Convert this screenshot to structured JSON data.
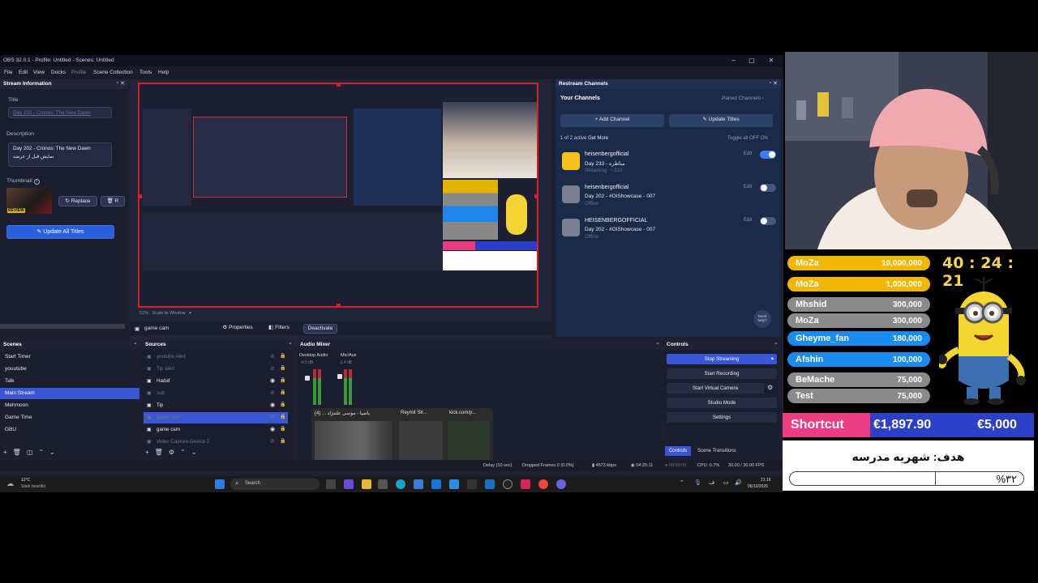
{
  "app": {
    "title": "OBS 32.0.1 - Profile: Untitled - Scenes: Untitled",
    "menu": [
      "File",
      "Edit",
      "View",
      "Docks",
      "Profile",
      "Scene Collection",
      "Tools",
      "Help"
    ]
  },
  "stream_info": {
    "dock_title": "Stream Information",
    "title_label": "Title",
    "title_value": "Day 202 - Cronos: The New Dawn",
    "description_label": "Description",
    "description_line1": "Day 202 - Cronos: The New Dawn",
    "description_line2": "نمایش قبل از عرضه",
    "thumbnail_label": "Thumbnail",
    "thumbnail_badge": "REVIEW",
    "replace_label": "Replace",
    "remove_label": "R",
    "update_all_label": "Update All Titles"
  },
  "preview": {
    "zoom": "51%",
    "scale_label": "Scale to Window"
  },
  "source_toolbar": {
    "source_name": "game cam",
    "properties_label": "Properties",
    "filters_label": "Filters",
    "deactivate_label": "Deactivate"
  },
  "restream": {
    "dock_title": "Restream Channels",
    "your_channels": "Your Channels",
    "paired_channels": "Paired Channels",
    "add_channel": "Add Channel",
    "update_titles": "Update Titles",
    "active_count": "1 of 2 active",
    "get_more": "Get More",
    "toggle_all": "Toggle all OFF",
    "toggle_all_on": "ON",
    "channels": [
      {
        "name": "heisenbergofficial",
        "title": "Day 233 - مناظره",
        "status": "Streaming",
        "viewers": "210",
        "edit": "Edit",
        "on": true
      },
      {
        "name": "heisenbergofficial",
        "title": "Day 202 - #OIShowcase - 007",
        "status": "Offline",
        "viewers": "",
        "edit": "Edit",
        "on": false
      },
      {
        "name": "HEISENBERGOFFICIAL",
        "title": "Day 202 - #OIShowcase - 007",
        "status": "Offline",
        "viewers": "",
        "edit": "Edit",
        "on": false
      }
    ],
    "need_help": "Need help?"
  },
  "scenes": {
    "title": "Scenes",
    "items": [
      "Start Timer",
      "youutube",
      "Talk",
      "Main Stream",
      "Mehmoon",
      "Game Time",
      "GBU"
    ],
    "selected": 3
  },
  "sources": {
    "title": "Sources",
    "items": [
      {
        "name": "youtube Alert",
        "dim": true
      },
      {
        "name": "Tip alert",
        "dim": true
      },
      {
        "name": "Hadaf",
        "dim": false
      },
      {
        "name": "sub",
        "dim": true
      },
      {
        "name": "Tip",
        "dim": false
      },
      {
        "name": "game cam",
        "dim": true,
        "sel": true
      },
      {
        "name": "game cam",
        "dim": false
      },
      {
        "name": "Video Capture Device 2",
        "dim": true
      }
    ]
  },
  "mixer": {
    "title": "Audio Mixer",
    "channels": [
      {
        "name": "Desktop Audio",
        "db": "-4.0 dB"
      },
      {
        "name": "Mic/Aux",
        "db": "-1.4 dB"
      }
    ]
  },
  "taskbar_preview": {
    "tabs": [
      "باصيا - موسى علىنژاد ... (4)",
      "Reymit Str...",
      "kick.com/p..."
    ]
  },
  "controls": {
    "title": "Controls",
    "buttons": [
      "Stop Streaming",
      "Start Recording",
      "Start Virtual Camera",
      "Studio Mode",
      "Settings"
    ],
    "tab_controls": "Controls",
    "tab_transitions": "Scene Transitions"
  },
  "status": {
    "delay": "Delay (10 sec)",
    "dropped": "Dropped Frames 0 (0.0%)",
    "bitrate": "4573 kbps",
    "stream_time": "04:25:11",
    "rec_time": "00:00:00",
    "cpu": "CPU: 0.7%",
    "fps": "30.00 / 30.00 FPS"
  },
  "taskbar": {
    "weather_temp": "12°C",
    "weather_desc": "Stark bewölkt",
    "search": "Search",
    "time": "21:16",
    "date": "06/10/2025"
  },
  "overlay": {
    "timer": "40 : 24 : 21",
    "donations": [
      {
        "name": "MoZa",
        "amount": "10,000,000",
        "color": "#f2b705"
      },
      {
        "name": "MoZa",
        "amount": "1,000,000",
        "color": "#f2b705"
      },
      {
        "name": "Mhshid",
        "amount": "300,000",
        "color": "#8a8a8a"
      },
      {
        "name": "MoZa",
        "amount": "300,000",
        "color": "#8a8a8a"
      },
      {
        "name": "Gheyme_fan",
        "amount": "180,000",
        "color": "#1a8cf0"
      },
      {
        "name": "Afshin",
        "amount": "100,000",
        "color": "#1a8cf0"
      },
      {
        "name": "BeMache",
        "amount": "75,000",
        "color": "#8a8a8a"
      },
      {
        "name": "Test",
        "amount": "75,000",
        "color": "#8a8a8a"
      }
    ],
    "shortcut_label": "Shortcut",
    "raised": "€1,897.90",
    "target": "€5,000",
    "goal_text": "هدف: شهریه مدرسه",
    "goal_percent": "%۳۲",
    "goal_progress": 0.38
  }
}
